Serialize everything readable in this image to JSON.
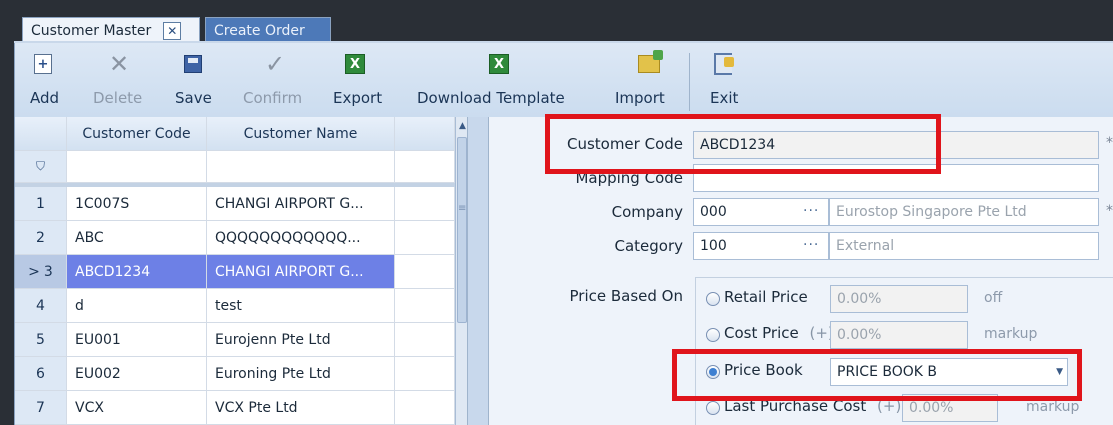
{
  "tabs": [
    {
      "label": "Customer Master",
      "close": "✕"
    },
    {
      "label": "Create Order"
    }
  ],
  "toolbar": {
    "add": "Add",
    "delete": "Delete",
    "save": "Save",
    "confirm": "Confirm",
    "export": "Export",
    "download_template": "Download Template",
    "import": "Import",
    "exit": "Exit",
    "icons": [
      "add-icon",
      "delete-icon",
      "save-icon",
      "confirm-icon",
      "excel-icon",
      "excel-icon",
      "import-icon",
      "exit-icon"
    ]
  },
  "grid": {
    "headers": [
      "Customer Code",
      "Customer Name"
    ],
    "filter_icon": "filter-icon",
    "rows": [
      {
        "no": "1",
        "code": "1C007S",
        "name": "CHANGI AIRPORT G..."
      },
      {
        "no": "2",
        "code": "ABC",
        "name": "QQQQQQQQQQQQ..."
      },
      {
        "no": "3",
        "marker": ">",
        "code": "ABCD1234",
        "name": "CHANGI AIRPORT G...",
        "selected": true
      },
      {
        "no": "4",
        "code": "d",
        "name": "test"
      },
      {
        "no": "5",
        "code": "EU001",
        "name": "Eurojenn Pte Ltd"
      },
      {
        "no": "6",
        "code": "EU002",
        "name": "Euroning Pte Ltd"
      },
      {
        "no": "7",
        "code": "VCX",
        "name": "VCX Pte Ltd"
      }
    ]
  },
  "form": {
    "customer_code_label": "Customer Code",
    "customer_code_value": "ABCD1234",
    "mapping_code_label": "Mapping Code",
    "mapping_code_value": "",
    "company_label": "Company",
    "company_code": "000",
    "company_name": "Eurostop Singapore Pte Ltd",
    "category_label": "Category",
    "category_code": "100",
    "category_name": "External",
    "ellipsis": "···",
    "required_mark": "*",
    "price_based_on_label": "Price Based On",
    "options": {
      "retail_label": "Retail Price",
      "retail_value": "0.00%",
      "retail_suffix": "off",
      "cost_label": "Cost Price",
      "cost_plus": "(+)",
      "cost_value": "0.00%",
      "cost_suffix": "markup",
      "pricebook_label": "Price Book",
      "pricebook_value": "PRICE BOOK B",
      "last_label": "Last Purchase Cost",
      "last_plus": "(+)",
      "last_value": "0.00%",
      "last_suffix": "markup"
    },
    "selected_option": "Price Book"
  },
  "colors": {
    "highlight_box": "#e0141b",
    "selected_row": "#6d80e6",
    "active_tab_bg": "#eef3fa",
    "inactive_tab_bg": "#4d79b8"
  }
}
